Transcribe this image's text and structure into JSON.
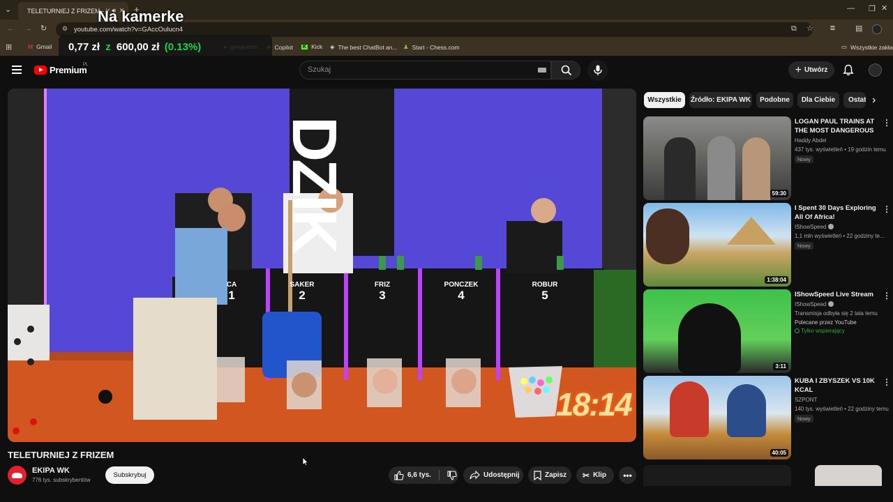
{
  "browser": {
    "tab_title": "TELETURNIEJ Z FRIZEM - Y",
    "url": "youtube.com/watch?v=GAccOulucn4",
    "bookmarks": [
      "Gmail",
      "geoguessr",
      "Copilot",
      "Kick",
      "The best ChatBot an...",
      "Start - Chess.com"
    ],
    "all_bookmarks": "Wszystkie zakładki"
  },
  "overlay": {
    "title": "Na kamerke",
    "amount": "0,77 zł",
    "of": "z",
    "goal": "600,00 zł",
    "percent": "(0.13%)"
  },
  "header": {
    "logo": "Premium",
    "region": "PL",
    "search_placeholder": "Szukaj",
    "create_label": "Utwórz"
  },
  "video": {
    "title": "TELETURNIEJ Z FRIZEM",
    "timer": "18:14",
    "wall_text": "DZIK",
    "podiums": [
      {
        "name": "CA",
        "num": "1"
      },
      {
        "name": "SAKER",
        "num": "2"
      },
      {
        "name": "FRIZ",
        "num": "3"
      },
      {
        "name": "PONCZEK",
        "num": "4"
      },
      {
        "name": "ROBUR",
        "num": "5"
      }
    ]
  },
  "channel": {
    "name": "EKIPA WK",
    "subs": "776 tys. subskrybentów",
    "subscribe": "Subskrybuj"
  },
  "actions": {
    "likes": "6,6 tys.",
    "share": "Udostępnij",
    "save": "Zapisz",
    "clip": "Klip"
  },
  "chips": [
    "Wszystkie",
    "Źródło: EKIPA WK",
    "Podobne",
    "Dla Ciebie",
    "Ostat"
  ],
  "recommendations": [
    {
      "title": "LOGAN PAUL TRAINS AT THE MOST DANGEROUS ...",
      "channel": "Haddy Abdel",
      "meta": "437 tys. wyświetleń • 19 godzin temu",
      "badge": "Nowy",
      "duration": "59:30"
    },
    {
      "title": "I Spent 30 Days Exploring All Of Africa!",
      "channel": "IShowSpeed",
      "meta": "1,1 mln wyświetleń • 22 godziny te...",
      "badge": "Nowy",
      "duration": "1:38:04"
    },
    {
      "title": "IShowSpeed Live Stream",
      "channel": "IShowSpeed",
      "meta": "Transmisja odbyła się 2 lata temu",
      "meta2": "Polecane przez YouTube",
      "members": "Tylko wspierający",
      "duration": "3:11"
    },
    {
      "title": "KUBA I ZBYSZEK VS 10K KCAL",
      "channel": "SZPONT",
      "meta": "140 tys. wyświetleń • 22 godziny temu",
      "badge": "Nowy",
      "duration": "40:05"
    }
  ],
  "colors": {
    "accent": "#ff0000",
    "bg": "#0f0f0f",
    "overlay_green": "#19d34b"
  }
}
